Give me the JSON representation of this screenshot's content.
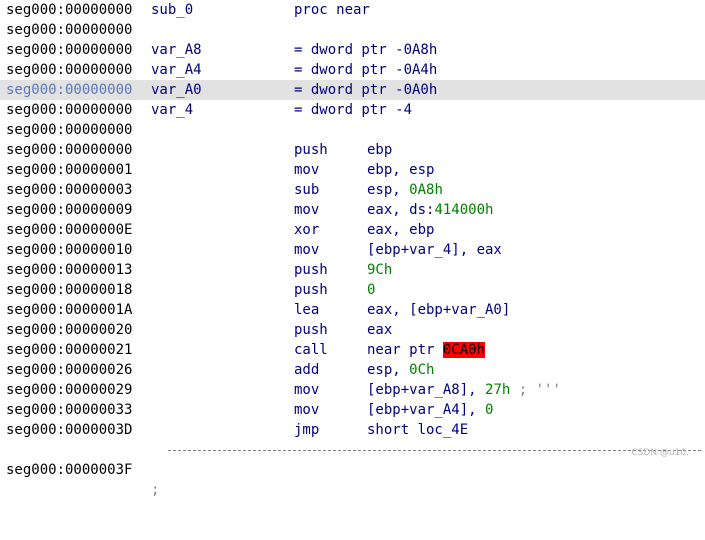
{
  "lines": [
    {
      "addr": "seg000:00000000",
      "label": "sub_0",
      "mnem": "proc near"
    },
    {
      "addr": "seg000:00000000"
    },
    {
      "addr": "seg000:00000000",
      "label": "var_A8",
      "mnem": "= dword ptr -0A8h"
    },
    {
      "addr": "seg000:00000000",
      "label": "var_A4",
      "mnem": "= dword ptr -0A4h"
    },
    {
      "addr": "seg000:00000000",
      "label": "var_A0",
      "mnem": "= dword ptr -0A0h",
      "highlight": true
    },
    {
      "addr": "seg000:00000000",
      "label": "var_4",
      "mnem": "= dword ptr -4"
    },
    {
      "addr": "seg000:00000000"
    },
    {
      "addr": "seg000:00000000",
      "mnem": "push",
      "ops": "ebp"
    },
    {
      "addr": "seg000:00000001",
      "mnem": "mov",
      "ops": "ebp, esp"
    },
    {
      "addr": "seg000:00000003",
      "mnem": "sub",
      "ops_a": "esp, ",
      "ops_num": "0A8h"
    },
    {
      "addr": "seg000:00000009",
      "mnem": "mov",
      "ops_a": "eax, ds:",
      "ops_num": "414000h"
    },
    {
      "addr": "seg000:0000000E",
      "mnem": "xor",
      "ops": "eax, ebp"
    },
    {
      "addr": "seg000:00000010",
      "mnem": "mov",
      "ops": "[ebp+var_4], eax"
    },
    {
      "addr": "seg000:00000013",
      "mnem": "push",
      "ops_num": "9Ch"
    },
    {
      "addr": "seg000:00000018",
      "mnem": "push",
      "ops_num": "0"
    },
    {
      "addr": "seg000:0000001A",
      "mnem": "lea",
      "ops": "eax, [ebp+var_A0]"
    },
    {
      "addr": "seg000:00000020",
      "mnem": "push",
      "ops": "eax"
    },
    {
      "addr": "seg000:00000021",
      "mnem": "call",
      "ops_a": "near ptr ",
      "ops_hl": "0CA0h"
    },
    {
      "addr": "seg000:00000026",
      "mnem": "add",
      "ops_a": "esp, ",
      "ops_num": "0Ch"
    },
    {
      "addr": "seg000:00000029",
      "mnem": "mov",
      "ops_a": "[ebp+var_A8], ",
      "ops_num": "27h",
      "comment": " ; '''"
    },
    {
      "addr": "seg000:00000033",
      "mnem": "mov",
      "ops_a": "[ebp+var_A4], ",
      "ops_num": "0"
    },
    {
      "addr": "seg000:0000003D",
      "mnem": "jmp",
      "ops": "short loc_4E"
    }
  ],
  "separator": {
    "addr": "seg000:0000003F",
    "semicolon": ";"
  },
  "watermark": "CSDN @u10."
}
